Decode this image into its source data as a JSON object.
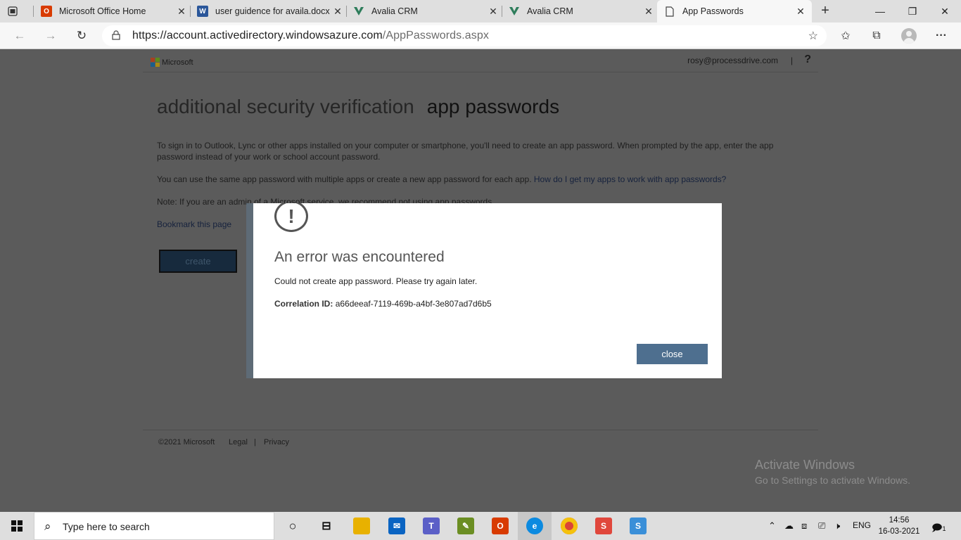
{
  "browser": {
    "tabs": [
      {
        "label": "Microsoft Office Home",
        "icon": "office-icon",
        "color": "#d83b01"
      },
      {
        "label": "user guidence for availa.docx",
        "icon": "word-icon",
        "color": "#2b579a"
      },
      {
        "label": "Avalia CRM",
        "icon": "avalia-icon",
        "color": "#2e7d5b"
      },
      {
        "label": "Avalia CRM",
        "icon": "avalia-icon",
        "color": "#2e7d5b"
      },
      {
        "label": "App Passwords",
        "icon": "page-icon",
        "color": "#555555"
      }
    ],
    "url_host": "https://account.activedirectory.windowsazure.com",
    "url_path": "/AppPasswords.aspx"
  },
  "header": {
    "brand": "Microsoft",
    "user": "rosy@processdrive.com",
    "separator": "|",
    "help": "?"
  },
  "main": {
    "title_part1": "additional security verification",
    "title_part2": "app passwords",
    "intro": "To sign in to Outlook, Lync or other apps installed on your computer or smartphone, you'll need to create an app password. When prompted by the app, enter the app password instead of your work or school account password.",
    "multi_text": "You can use the same app password with multiple apps or create a new app password for each app.",
    "multi_link": "How do I get my apps to work with app passwords?",
    "note": "Note: If you are an admin of a Microsoft service, we recommend not using app passwords.",
    "bookmark": "Bookmark this page",
    "create_label": "create"
  },
  "dialog": {
    "icon": "!",
    "title": "An error was encountered",
    "message": "Could not create app password. Please try again later.",
    "correlation_label": "Correlation ID:",
    "correlation_id": "a66deeaf-7119-469b-a4bf-3e807ad7d6b5",
    "close_label": "close"
  },
  "footer": {
    "copyright": "©2021 Microsoft",
    "legal": "Legal",
    "separator": "|",
    "privacy": "Privacy"
  },
  "watermark": {
    "line1": "Activate Windows",
    "line2": "Go to Settings to activate Windows."
  },
  "taskbar": {
    "search_placeholder": "Type here to search",
    "lang": "ENG",
    "time": "14:56",
    "date": "16-03-2021",
    "notification_count": "1"
  }
}
